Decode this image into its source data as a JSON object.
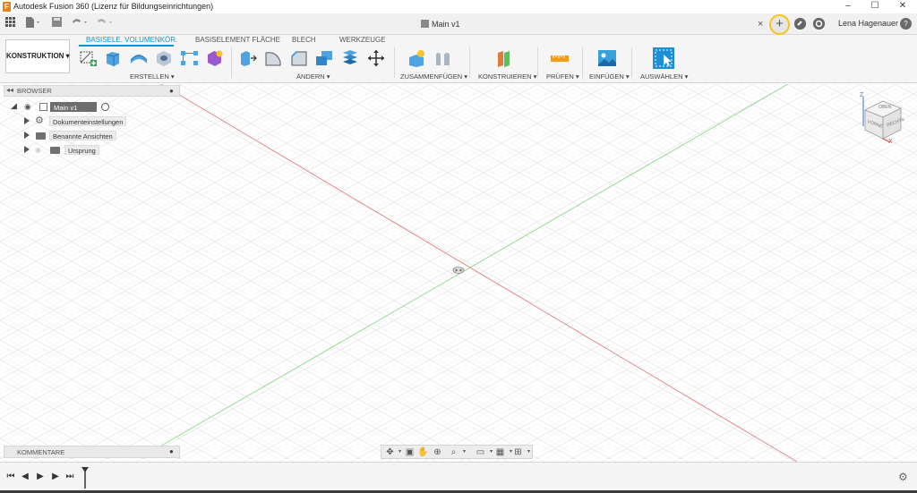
{
  "window": {
    "title": "Autodesk Fusion 360 (Lizenz für Bildungseinrichtungen)",
    "logo_letter": "F",
    "minimize": "–",
    "maximize": "☐",
    "close": "✕"
  },
  "quickbar": {
    "document_name": "Main v1",
    "close_tab": "×",
    "new_tab": "+",
    "user": "Lena Hagenauer",
    "help": "?"
  },
  "ribbon": {
    "workspace": "KONSTRUKTION ▾",
    "tabs": [
      {
        "label": "BASISELE. VOLUMENKÖR.",
        "active": true
      },
      {
        "label": "BASISELEMENT FLÄCHE",
        "active": false
      },
      {
        "label": "BLECH",
        "active": false
      },
      {
        "label": "WERKZEUGE",
        "active": false
      }
    ],
    "groups": {
      "create": "ERSTELLEN ▾",
      "modify": "ÄNDERN ▾",
      "assemble": "ZUSAMMENFÜGEN ▾",
      "construct": "KONSTRUIEREN ▾",
      "inspect": "PRÜFEN ▾",
      "insert": "EINFÜGEN ▾",
      "select": "AUSWÄHLEN ▾"
    }
  },
  "browser": {
    "title": "BROWSER",
    "root": "Main v1",
    "items": [
      {
        "label": "Dokumenteinstellungen",
        "icon": "gear-icon"
      },
      {
        "label": "Benannte Ansichten",
        "icon": "folder-icon"
      },
      {
        "label": "Ursprung",
        "icon": "folder-icon"
      }
    ]
  },
  "viewcube": {
    "top": "OBEN",
    "front": "VORNE",
    "right": "RECHTS",
    "axis_z": "Z",
    "axis_x": "X"
  },
  "comments": {
    "title": "KOMMENTARE"
  },
  "colors": {
    "accent": "#0696d7",
    "highlight": "#f5c518",
    "x_axis": "#e08080",
    "y_axis": "#8fd88f",
    "grid": "#e6e6e6"
  }
}
